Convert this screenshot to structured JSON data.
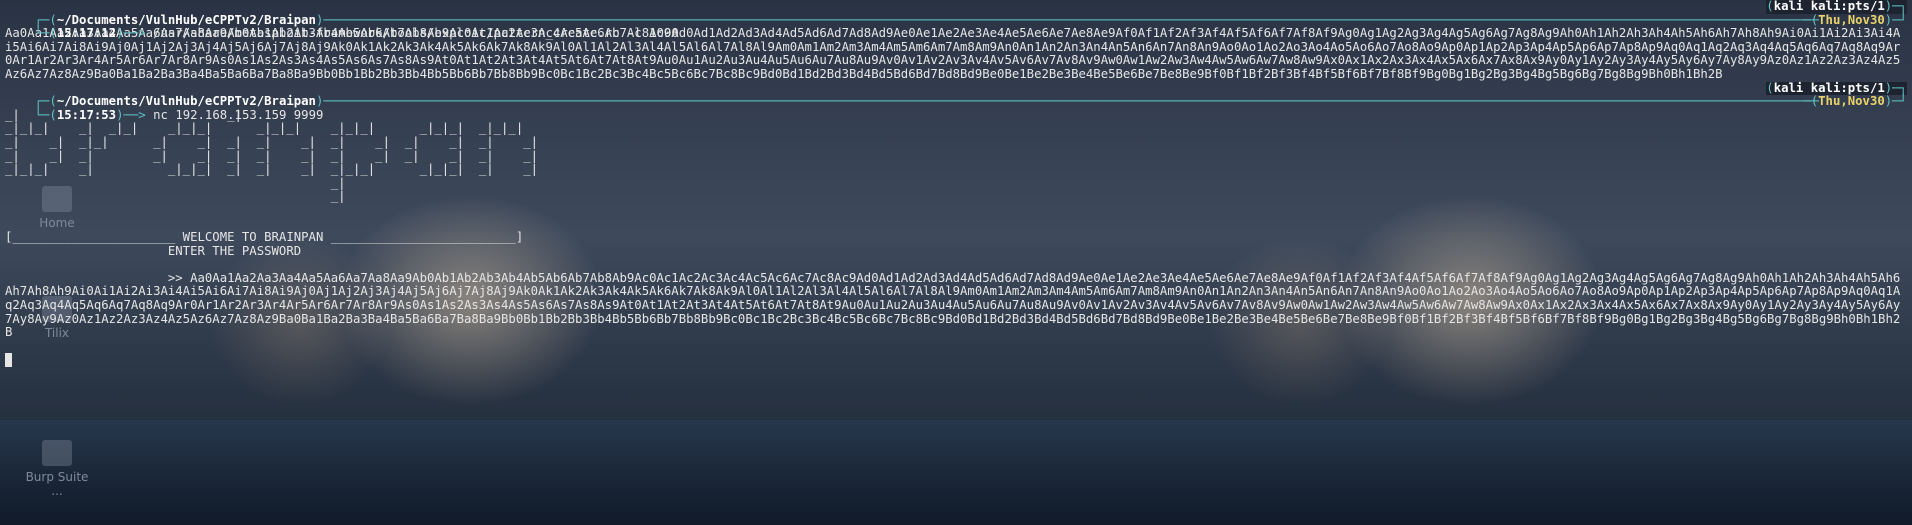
{
  "desktop": {
    "icons": [
      {
        "label": "Home"
      },
      {
        "label": "Tilix"
      },
      {
        "label": "Burp Suite ..."
      }
    ]
  },
  "session1": {
    "path": "~/Documents/VulnHub/eCPPTv2/Braipan",
    "time": "15:17:12",
    "command": "/usr/share/metasploit-framework/tools/exploit/pattern_create.rb -l 1000",
    "host": "kali",
    "tty": "kali:pts/1",
    "date": "Thu,Nov30",
    "output": "Aa0Aa1Aa2Aa3Aa4Aa5Aa6Aa7Aa8Aa9Ab0Ab1Ab2Ab3Ab4Ab5Ab6Ab7Ab8Ab9Ac0Ac1Ac2Ac3Ac4Ac5Ac6Ac7Ac8Ac9Ad0Ad1Ad2Ad3Ad4Ad5Ad6Ad7Ad8Ad9Ae0Ae1Ae2Ae3Ae4Ae5Ae6Ae7Ae8Ae9Af0Af1Af2Af3Af4Af5Af6Af7Af8Af9Ag0Ag1Ag2Ag3Ag4Ag5Ag6Ag7Ag8Ag9Ah0Ah1Ah2Ah3Ah4Ah5Ah6Ah7Ah8Ah9Ai0Ai1Ai2Ai3Ai4Ai5Ai6Ai7Ai8Ai9Aj0Aj1Aj2Aj3Aj4Aj5Aj6Aj7Aj8Aj9Ak0Ak1Ak2Ak3Ak4Ak5Ak6Ak7Ak8Ak9Al0Al1Al2Al3Al4Al5Al6Al7Al8Al9Am0Am1Am2Am3Am4Am5Am6Am7Am8Am9An0An1An2An3An4An5An6An7An8An9Ao0Ao1Ao2Ao3Ao4Ao5Ao6Ao7Ao8Ao9Ap0Ap1Ap2Ap3Ap4Ap5Ap6Ap7Ap8Ap9Aq0Aq1Aq2Aq3Aq4Aq5Aq6Aq7Aq8Aq9Ar0Ar1Ar2Ar3Ar4Ar5Ar6Ar7Ar8Ar9As0As1As2As3As4As5As6As7As8As9At0At1At2At3At4At5At6At7At8At9Au0Au1Au2Au3Au4Au5Au6Au7Au8Au9Av0Av1Av2Av3Av4Av5Av6Av7Av8Av9Aw0Aw1Aw2Aw3Aw4Aw5Aw6Aw7Aw8Aw9Ax0Ax1Ax2Ax3Ax4Ax5Ax6Ax7Ax8Ax9Ay0Ay1Ay2Ay3Ay4Ay5Ay6Ay7Ay8Ay9Az0Az1Az2Az3Az4Az5Az6Az7Az8Az9Ba0Ba1Ba2Ba3Ba4Ba5Ba6Ba7Ba8Ba9Bb0Bb1Bb2Bb3Bb4Bb5Bb6Bb7Bb8Bb9Bc0Bc1Bc2Bc3Bc4Bc5Bc6Bc7Bc8Bc9Bd0Bd1Bd2Bd3Bd4Bd5Bd6Bd7Bd8Bd9Be0Be1Be2Be3Be4Be5Be6Be7Be8Be9Bf0Bf1Bf2Bf3Bf4Bf5Bf6Bf7Bf8Bf9Bg0Bg1Bg2Bg3Bg4Bg5Bg6Bg7Bg8Bg9Bh0Bh1Bh2B"
  },
  "session2": {
    "path": "~/Documents/VulnHub/eCPPTv2/Braipan",
    "time": "15:17:53",
    "command": "nc 192.168.153.159 9999",
    "host": "kali",
    "tty": "kali:pts/1",
    "date": "Thu,Nov30",
    "banner_art": "_|                            _|\n_|_|_|    _|  _|_|    _|_|_|      _|_|_|    _|_|_|      _|_|_|  _|_|_|\n_|    _|  _|_|      _|    _|  _|  _|    _|  _|    _|  _|    _|  _|    _|\n_|    _|  _|        _|    _|  _|  _|    _|  _|    _|  _|    _|  _|    _|\n_|_|_|    _|          _|_|_|  _|  _|    _|  _|_|_|      _|_|_|  _|    _|\n                                            _|\n                                            _|",
    "welcome_line": "[______________________ WELCOME TO BRAINPAN _________________________]",
    "password_prompt": "                      ENTER THE PASSWORD",
    "input_echo": "                      >> Aa0Aa1Aa2Aa3Aa4Aa5Aa6Aa7Aa8Aa9Ab0Ab1Ab2Ab3Ab4Ab5Ab6Ab7Ab8Ab9Ac0Ac1Ac2Ac3Ac4Ac5Ac6Ac7Ac8Ac9Ad0Ad1Ad2Ad3Ad4Ad5Ad6Ad7Ad8Ad9Ae0Ae1Ae2Ae3Ae4Ae5Ae6Ae7Ae8Ae9Af0Af1Af2Af3Af4Af5Af6Af7Af8Af9Ag0Ag1Ag2Ag3Ag4Ag5Ag6Ag7Ag8Ag9Ah0Ah1Ah2Ah3Ah4Ah5Ah6Ah7Ah8Ah9Ai0Ai1Ai2Ai3Ai4Ai5Ai6Ai7Ai8Ai9Aj0Aj1Aj2Aj3Aj4Aj5Aj6Aj7Aj8Aj9Ak0Ak1Ak2Ak3Ak4Ak5Ak6Ak7Ak8Ak9Al0Al1Al2Al3Al4Al5Al6Al7Al8Al9Am0Am1Am2Am3Am4Am5Am6Am7Am8Am9An0An1An2An3An4An5An6An7An8An9Ao0Ao1Ao2Ao3Ao4Ao5Ao6Ao7Ao8Ao9Ap0Ap1Ap2Ap3Ap4Ap5Ap6Ap7Ap8Ap9Aq0Aq1Aq2Aq3Aq4Aq5Aq6Aq7Aq8Aq9Ar0Ar1Ar2Ar3Ar4Ar5Ar6Ar7Ar8Ar9As0As1As2As3As4As5As6As7As8As9At0At1At2At3At4At5At6At7At8At9Au0Au1Au2Au3Au4Au5Au6Au7Au8Au9Av0Av1Av2Av3Av4Av5Av6Av7Av8Av9Aw0Aw1Aw2Aw3Aw4Aw5Aw6Aw7Aw8Aw9Ax0Ax1Ax2Ax3Ax4Ax5Ax6Ax7Ax8Ax9Ay0Ay1Ay2Ay3Ay4Ay5Ay6Ay7Ay8Ay9Az0Az1Az2Az3Az4Az5Az6Az7Az8Az9Ba0Ba1Ba2Ba3Ba4Ba5Ba6Ba7Ba8Ba9Bb0Bb1Bb2Bb3Bb4Bb5Bb6Bb7Bb8Bb9Bc0Bc1Bc2Bc3Bc4Bc5Bc6Bc7Bc8Bc9Bd0Bd1Bd2Bd3Bd4Bd5Bd6Bd7Bd8Bd9Be0Be1Be2Be3Be4Be5Be6Be7Be8Be9Bf0Bf1Bf2Bf3Bf4Bf5Bf6Bf7Bf8Bf9Bg0Bg1Bg2Bg3Bg4Bg5Bg6Bg7Bg8Bg9Bh0Bh1Bh2B"
  },
  "colors": {
    "prompt_accent": "#5fc4c4",
    "date_accent": "#e9d36a",
    "text": "#e6e6e6"
  }
}
